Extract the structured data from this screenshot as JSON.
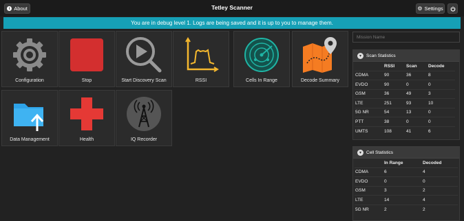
{
  "header": {
    "title": "Tetley Scanner",
    "about_label": "About",
    "settings_label": "Settings"
  },
  "banner": {
    "message": "You are in debug level 1. Logs are being saved and it is up to you to manage them."
  },
  "tiles": [
    {
      "label": "Configuration",
      "icon": "gear-icon"
    },
    {
      "label": "Stop",
      "icon": "stop-icon"
    },
    {
      "label": "Start Discovery Scan",
      "icon": "play-magnifier-icon"
    },
    {
      "label": "RSSI",
      "icon": "rssi-graph-icon"
    },
    {
      "label": "Cells In Range",
      "icon": "radar-icon"
    },
    {
      "label": "Decode Summary",
      "icon": "map-pin-icon"
    },
    {
      "label": "Data Management",
      "icon": "folder-upload-icon"
    },
    {
      "label": "Health",
      "icon": "health-cross-icon"
    },
    {
      "label": "IQ Recorder",
      "icon": "antenna-tower-icon"
    }
  ],
  "mission": {
    "placeholder": "Mission Name"
  },
  "scan_statistics": {
    "title": "Scan Statistics",
    "columns": [
      "",
      "RSSI",
      "Scan",
      "Decode"
    ],
    "rows": [
      [
        "CDMA",
        "90",
        "36",
        "8"
      ],
      [
        "EVDO",
        "90",
        "0",
        "0"
      ],
      [
        "GSM",
        "36",
        "49",
        "3"
      ],
      [
        "LTE",
        "251",
        "93",
        "10"
      ],
      [
        "5G NR",
        "54",
        "13",
        "0"
      ],
      [
        "PTT",
        "38",
        "0",
        "0"
      ],
      [
        "UMTS",
        "108",
        "41",
        "6"
      ]
    ]
  },
  "cell_statistics": {
    "title": "Cell Statistics",
    "columns": [
      "",
      "In Range",
      "Decoded"
    ],
    "rows": [
      [
        "CDMA",
        "6",
        "4"
      ],
      [
        "EVDO",
        "0",
        "0"
      ],
      [
        "GSM",
        "3",
        "2"
      ],
      [
        "LTE",
        "14",
        "4"
      ],
      [
        "5G NR",
        "2",
        "2"
      ]
    ]
  },
  "colors": {
    "banner": "#16a0b6",
    "stop": "#d32f2f",
    "health": "#e53935",
    "rssi": "#f5b82e",
    "radar": "#1fb5a5",
    "map": "#f57c22",
    "folder": "#2ea3e8"
  }
}
